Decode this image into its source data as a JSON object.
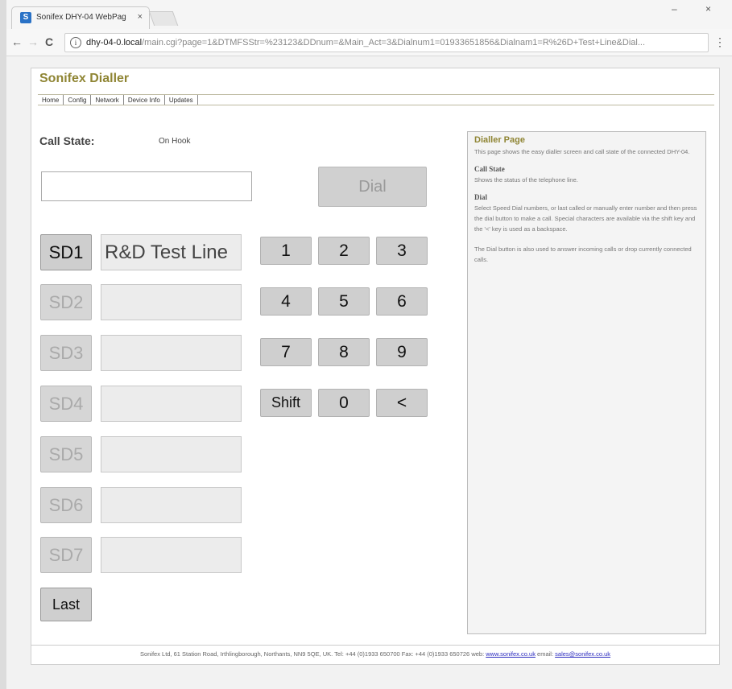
{
  "browser": {
    "tab_title": "Sonifex DHY-04 WebPag",
    "tab_close": "×",
    "favicon_letter": "S",
    "url_host": "dhy-04-0.local",
    "url_rest": "/main.cgi?page=1&DTMFSStr=%23123&DDnum=&Main_Act=3&Dialnum1=01933651856&Dialnam1=R%26D+Test+Line&Dial...",
    "info_glyph": "i",
    "back_glyph": "←",
    "forward_glyph": "→",
    "reload_glyph": "C",
    "menu_glyph": "⋮",
    "minimize_glyph": "–",
    "close_glyph": "×"
  },
  "app": {
    "title": "Sonifex Dialler",
    "nav": [
      "Home",
      "Config",
      "Network",
      "Device Info",
      "Updates"
    ]
  },
  "call_state": {
    "label": "Call State:",
    "value": "On Hook"
  },
  "dial_input_value": "",
  "dial_button": "Dial",
  "speed_dials": [
    {
      "label": "SD1",
      "name": "R&D Test Line",
      "active": true
    },
    {
      "label": "SD2",
      "name": "",
      "active": false
    },
    {
      "label": "SD3",
      "name": "",
      "active": false
    },
    {
      "label": "SD4",
      "name": "",
      "active": false
    },
    {
      "label": "SD5",
      "name": "",
      "active": false
    },
    {
      "label": "SD6",
      "name": "",
      "active": false
    },
    {
      "label": "SD7",
      "name": "",
      "active": false
    }
  ],
  "keypad": [
    "1",
    "2",
    "3",
    "4",
    "5",
    "6",
    "7",
    "8",
    "9",
    "Shift",
    "0",
    "<"
  ],
  "last_button": "Last",
  "help": {
    "title": "Dialler Page",
    "intro": "This page shows the easy dialler screen and call state of the connected DHY-04.",
    "sections": [
      {
        "heading": "Call State",
        "text": "Shows the status of the telephone line."
      },
      {
        "heading": "Dial",
        "text": "Select Speed Dial numbers, or last called or manually enter number and then press the dial button to make a call. Special characters are available via the shift key and the '<' key is used as a backspace."
      },
      {
        "heading": "",
        "text": "The Dial button is also used to answer incoming calls or drop currently connected calls."
      }
    ]
  },
  "footer": {
    "text": "Sonifex Ltd, 61 Station Road, Irthlingborough, Northants, NN9 5QE, UK. Tel: +44 (0)1933 650700 Fax: +44 (0)1933 650726 web:",
    "web_link": "www.sonifex.co.uk",
    "email_label": "email:",
    "email_link": "sales@sonifex.co.uk"
  },
  "colors": {
    "title_olive": "#8f8534",
    "button_grey": "#d0d0d0",
    "link_blue": "#2b2bbf"
  }
}
